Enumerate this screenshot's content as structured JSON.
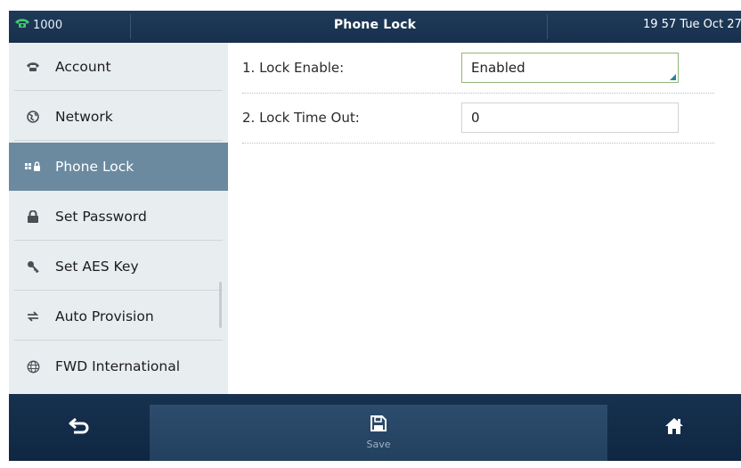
{
  "status_bar": {
    "line": "1000",
    "title": "Phone Lock",
    "clock": "19 57 Tue Oct 27"
  },
  "sidebar": {
    "items": [
      {
        "label": "Account",
        "icon": "phone-icon"
      },
      {
        "label": "Network",
        "icon": "globe-icon"
      },
      {
        "label": "Phone Lock",
        "icon": "keypad-lock-icon",
        "active": true
      },
      {
        "label": "Set Password",
        "icon": "lock-icon"
      },
      {
        "label": "Set AES Key",
        "icon": "key-icon"
      },
      {
        "label": "Auto Provision",
        "icon": "sync-icon"
      },
      {
        "label": "FWD International",
        "icon": "world-icon"
      }
    ]
  },
  "settings": [
    {
      "label": "1. Lock Enable:",
      "value": "Enabled",
      "type": "select"
    },
    {
      "label": "2. Lock Time Out:",
      "value": "0",
      "type": "input"
    }
  ],
  "softkeys": {
    "back_icon": "back-arrow-icon",
    "save_label": "Save",
    "save_icon": "save-icon",
    "home_icon": "home-icon"
  },
  "colors": {
    "topbar": "#1f3a5a",
    "active_item": "#6b8aa0",
    "softkey_bar": "#0f2742",
    "select_corner": "#2f7ea6"
  }
}
